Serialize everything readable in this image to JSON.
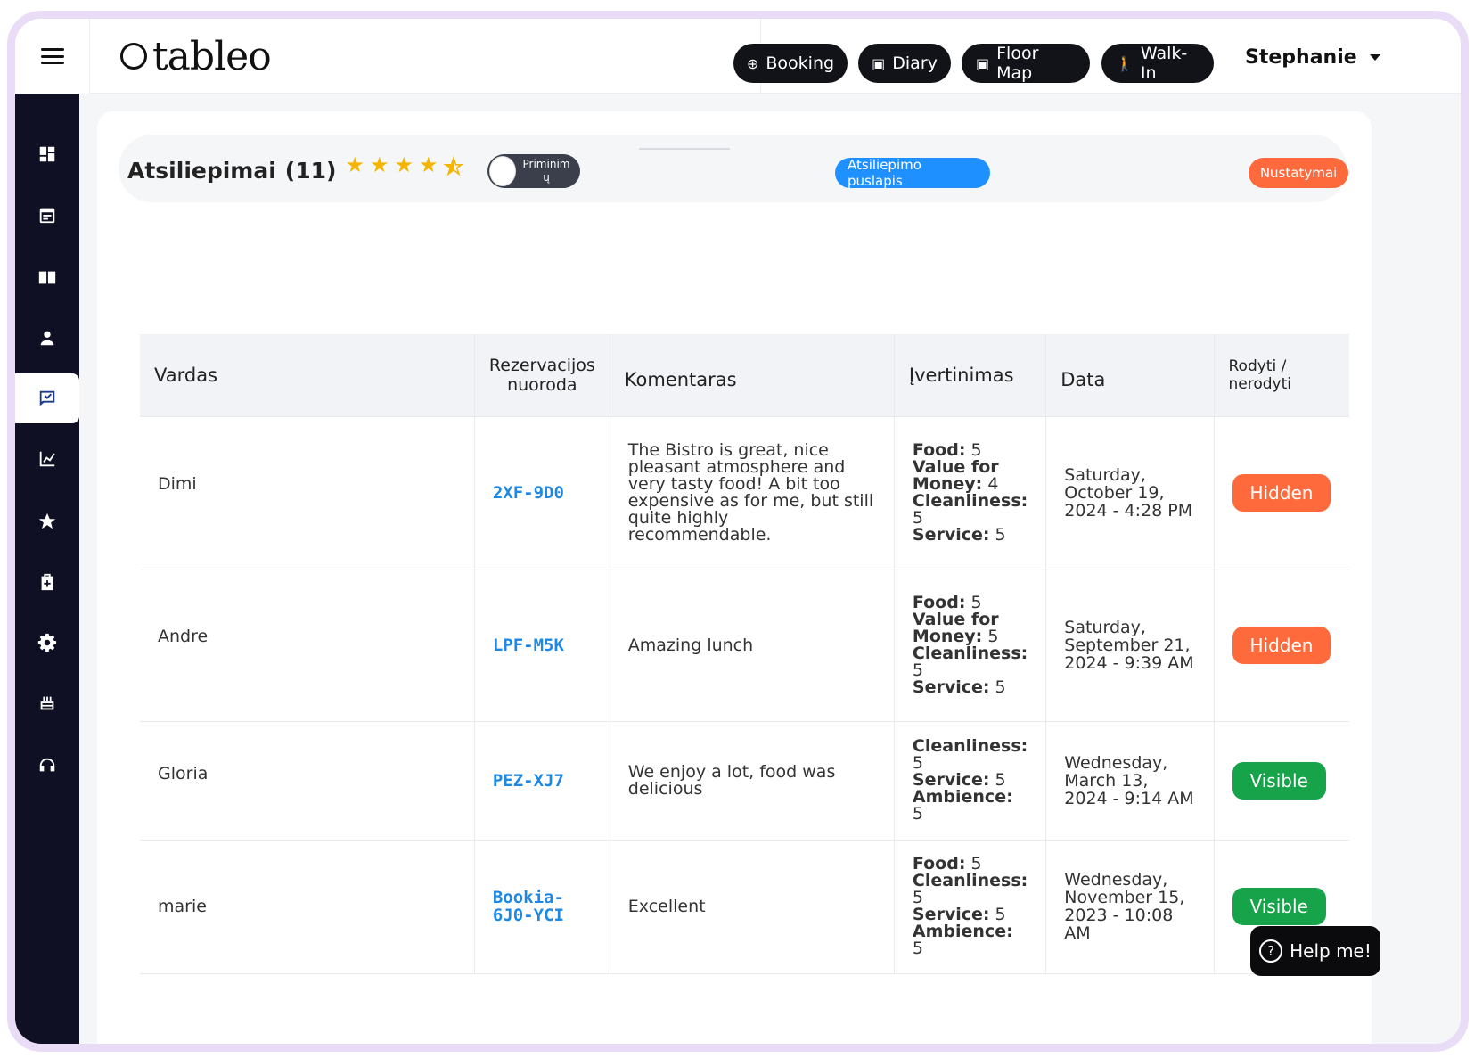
{
  "header": {
    "logo_text": "tableo",
    "buttons": [
      {
        "label": "Booking",
        "icon": "plus-circle-icon"
      },
      {
        "label": "Diary",
        "icon": "calendar-icon"
      },
      {
        "label": "Floor Map",
        "icon": "calendar-icon"
      },
      {
        "label": "Walk-In",
        "icon": "walking-icon"
      }
    ],
    "user_name": "Stephanie"
  },
  "sidebar": {
    "items": [
      {
        "icon": "dashboard-icon"
      },
      {
        "icon": "calendar-icon"
      },
      {
        "icon": "book-icon"
      },
      {
        "icon": "user-icon"
      },
      {
        "icon": "feedback-icon",
        "active": true
      },
      {
        "icon": "chart-icon"
      },
      {
        "icon": "star-icon"
      },
      {
        "icon": "gift-card-icon"
      },
      {
        "icon": "gear-icon"
      },
      {
        "icon": "cake-icon"
      },
      {
        "icon": "headphones-icon"
      }
    ]
  },
  "page": {
    "title": "Atsiliepimai",
    "count": "(11)",
    "rating_stars": 4.5,
    "toggle_label": "Priminim\nų",
    "reviews_page_button": "Atsiliepimo puslapis",
    "settings_button": "Nustatymai"
  },
  "table": {
    "headers": [
      "Vardas",
      "Rezervacijos nuoroda",
      "Komentaras",
      "Įvertinimas",
      "Data",
      "Rodyti / nerodyti"
    ],
    "rows": [
      {
        "name": "Dimi",
        "code": "2XF-9D0",
        "comment": "The Bistro is great, nice pleasant atmosphere and very tasty food! A bit too expensive as for me, but still quite highly recommendable.",
        "ratings": [
          [
            "Food:",
            "5"
          ],
          [
            "Value for Money:",
            "4"
          ],
          [
            "Cleanliness:",
            "5"
          ],
          [
            "Service:",
            "5"
          ]
        ],
        "date": "Saturday, October 19, 2024 - 4:28 PM",
        "status": "Hidden"
      },
      {
        "name": "Andre",
        "code": "LPF-M5K",
        "comment": "Amazing lunch",
        "ratings": [
          [
            "Food:",
            "5"
          ],
          [
            "Value for Money:",
            "5"
          ],
          [
            "Cleanliness:",
            "5"
          ],
          [
            "Service:",
            "5"
          ]
        ],
        "date": "Saturday, September 21, 2024 - 9:39 AM",
        "status": "Hidden"
      },
      {
        "name": "Gloria",
        "code": "PEZ-XJ7",
        "comment": "We enjoy a lot, food was delicious",
        "ratings": [
          [
            "Cleanliness:",
            "5"
          ],
          [
            "Service:",
            "5"
          ],
          [
            "Ambience:",
            "5"
          ]
        ],
        "date": "Wednesday, March 13, 2024 - 9:14 AM",
        "status": "Visible"
      },
      {
        "name": "marie",
        "code": "Bookia-6J0-YCI",
        "comment": "Excellent",
        "ratings": [
          [
            "Food:",
            "5"
          ],
          [
            "Cleanliness:",
            "5"
          ],
          [
            "Service:",
            "5"
          ],
          [
            "Ambience:",
            "5"
          ]
        ],
        "date": "Wednesday, November 15, 2023 - 10:08 AM",
        "status": "Visible"
      }
    ]
  },
  "help_button": "Help me!",
  "colors": {
    "sidebar_bg": "#0f1024",
    "hidden": "#ff6a3d",
    "visible": "#16a34a",
    "link": "#1e88e5",
    "star": "#f4b400"
  }
}
